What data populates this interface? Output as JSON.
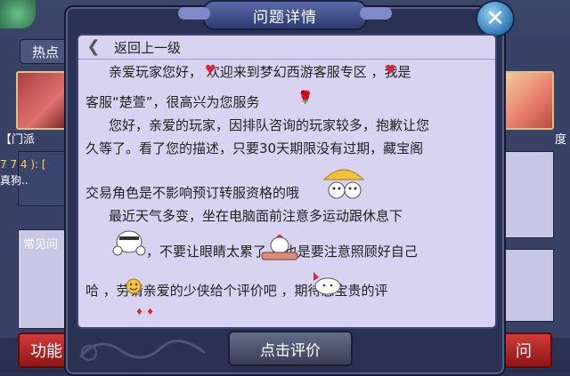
{
  "background": {
    "tab_hot": "热点",
    "left_label": "【门派",
    "right_label": "度",
    "left_chat_line1": "7 7 4 ): [",
    "left_chat_line2": "真狗..",
    "left_faq": "常见问",
    "func_button": "功能",
    "ask_button": "问"
  },
  "modal": {
    "title": "问题详情",
    "back_label": "返回上一级",
    "bottom_button": "点击评价",
    "lines": [
      "亲爱玩家您好，  欢迎来到梦幻西游客服专区  ，我是",
      "客服“楚萱”，很高兴为您服务",
      "您好，亲爱的玩家，因排队咨询的玩家较多，抱歉让您",
      "久等了。看了您的描述，只要30天期限没有过期，藏宝阁",
      "交易角色是不影响预订转服资格的哦",
      "最近天气多变，坐在电脑面前注意多运动跟休息下",
      "，不要让眼睛太累了      您也是要注意照顾好自己",
      "哈  ，劳请亲爱的少侠给个评价吧     ，期待您宝贵的评"
    ]
  },
  "colors": {
    "content_bg": "#d7d3f1",
    "modal_bg": "#2b3152",
    "button_red": "#d23a3a",
    "close_blue": "#2d77b3"
  }
}
